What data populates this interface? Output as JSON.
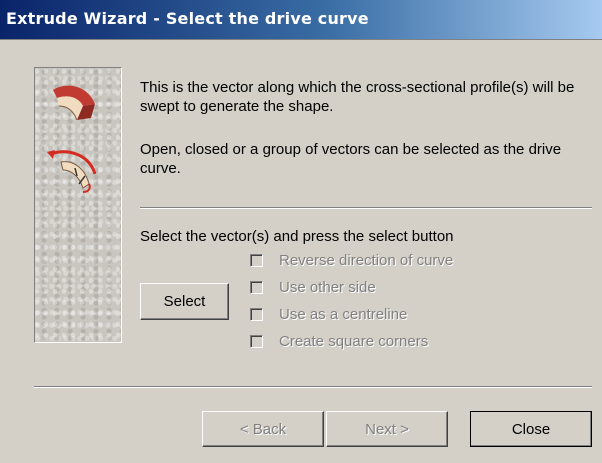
{
  "window": {
    "title": "Extrude Wizard - Select the drive curve"
  },
  "description": {
    "line1": "This is the vector along which the cross-sectional profile(s) will be swept to generate the shape.",
    "line2": "Open, closed or a group of vectors can be selected as the drive curve."
  },
  "selection": {
    "instruction": "Select the vector(s) and press the select button",
    "select_label": "Select",
    "options": [
      {
        "label": "Reverse direction of curve",
        "checked": false,
        "enabled": false
      },
      {
        "label": "Use other side",
        "checked": false,
        "enabled": false
      },
      {
        "label": "Use as a centreline",
        "checked": false,
        "enabled": false
      },
      {
        "label": "Create square corners",
        "checked": false,
        "enabled": false
      }
    ]
  },
  "footer": {
    "back_label": "< Back",
    "next_label": "Next >",
    "close_label": "Close"
  },
  "icons": {
    "profile": "extrude-profile-icon",
    "curve": "drive-curve-icon"
  },
  "colors": {
    "title_gradient_start": "#0a246a",
    "title_gradient_end": "#a6caf0",
    "face": "#d4d0c8",
    "disabled_text": "#808080"
  }
}
